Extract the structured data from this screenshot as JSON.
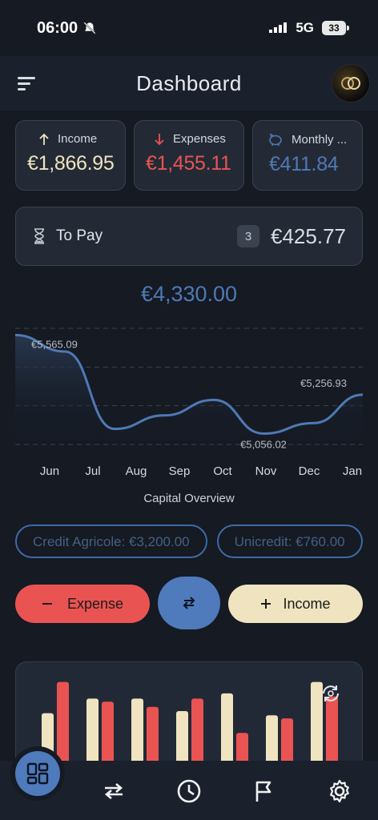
{
  "status": {
    "time": "06:00",
    "network": "5G",
    "battery": "33"
  },
  "header": {
    "title": "Dashboard"
  },
  "summary": [
    {
      "label": "Income",
      "value": "€1,866.95",
      "color": "#efe4bf"
    },
    {
      "label": "Expenses",
      "value": "€1,455.11",
      "color": "#e95452"
    },
    {
      "label": "Monthly ...",
      "value": "€411.84",
      "color": "#4f79b5"
    }
  ],
  "to_pay": {
    "label": "To Pay",
    "count": "3",
    "amount": "€425.77"
  },
  "capital": {
    "total": "€4,330.00",
    "caption": "Capital Overview"
  },
  "chart_data": {
    "type": "line",
    "x": [
      "Jun",
      "Jul",
      "Aug",
      "Sep",
      "Oct",
      "Nov",
      "Dec",
      "Jan"
    ],
    "values": [
      5565.09,
      5480,
      5080,
      5150,
      5230,
      5056.02,
      5110,
      5256.93
    ],
    "annotations": [
      "€5,565.09",
      "€5,056.02",
      "€5,256.93"
    ],
    "ylim": [
      5000,
      5600
    ],
    "grid": true,
    "color": "#4f79b5"
  },
  "accounts": [
    "Credit Agricole: €3,200.00",
    "Unicredit: €760.00"
  ],
  "actions": {
    "expense": "Expense",
    "income": "Income"
  },
  "bars_chart": {
    "type": "bar",
    "series": [
      {
        "values": [
          0.48,
          0.62,
          0.62,
          0.5,
          0.67,
          0.46,
          0.78
        ],
        "color": "#efe4bf"
      },
      {
        "values": [
          0.78,
          0.59,
          0.54,
          0.62,
          0.29,
          0.43,
          0.64
        ],
        "color": "#e95452"
      }
    ]
  }
}
